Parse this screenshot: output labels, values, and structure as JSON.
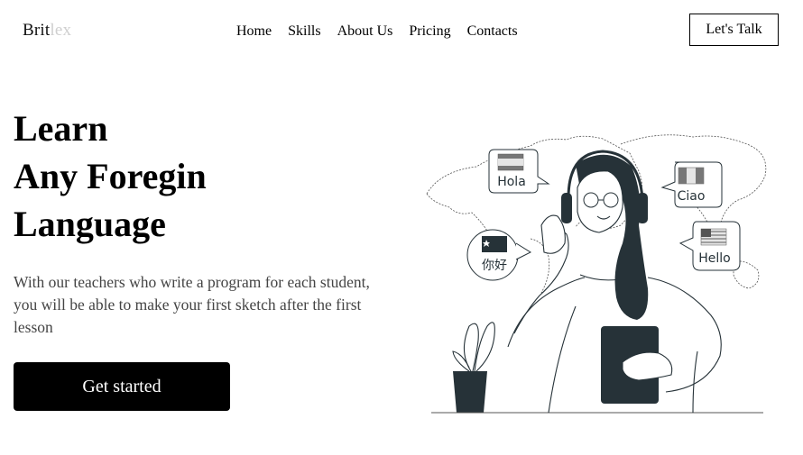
{
  "header": {
    "logo_part1": "Brit",
    "logo_part2": "lex",
    "nav": [
      "Home",
      "Skills",
      "About Us",
      "Pricing",
      "Contacts"
    ],
    "cta_label": "Let's Talk"
  },
  "hero": {
    "title_lines": [
      "Learn",
      "Any Foregin",
      "Language"
    ],
    "description": "With our teachers who write a program for each student, you will be able to make your first sketch after the first lesson",
    "button_label": "Get started"
  },
  "illustration": {
    "bubbles": [
      "Hola",
      "Ciao",
      "你好",
      "Hello"
    ]
  },
  "colors": {
    "text": "#000000",
    "muted": "#444444",
    "logo_accent": "#cfcfcf",
    "illustration_dark": "#263238"
  }
}
